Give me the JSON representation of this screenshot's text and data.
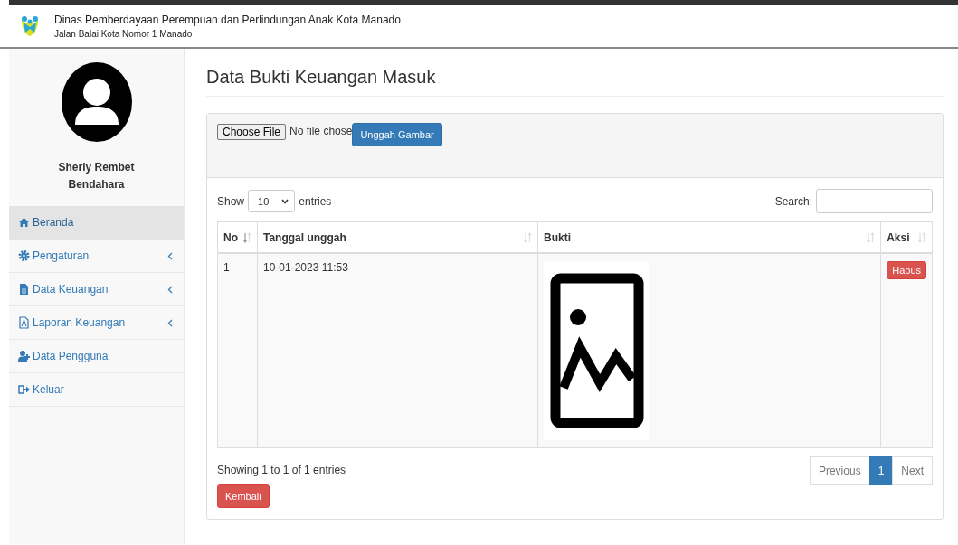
{
  "header": {
    "title": "Dinas Pemberdayaan Perempuan dan Perlindungan Anak Kota Manado",
    "subtitle": "Jalan Balai Kota Nomor 1 Manado"
  },
  "sidebar": {
    "user_name": "Sherly Rembet",
    "user_role": "Bendahara",
    "items": [
      {
        "label": "Beranda",
        "selected": true,
        "expandable": false
      },
      {
        "label": "Pengaturan",
        "selected": false,
        "expandable": true
      },
      {
        "label": "Data Keuangan",
        "selected": false,
        "expandable": true
      },
      {
        "label": "Laporan Keuangan",
        "selected": false,
        "expandable": true
      },
      {
        "label": "Data Pengguna",
        "selected": false,
        "expandable": false
      },
      {
        "label": "Keluar",
        "selected": false,
        "expandable": false
      }
    ]
  },
  "page_title": "Data Bukti Keuangan Masuk",
  "upload": {
    "choose_button": "Choose File",
    "file_status": "No file chose",
    "upload_button": "Unggah Gambar"
  },
  "table": {
    "show_label": "Show",
    "page_size": "10",
    "entries_label": "entries",
    "search_label": "Search:",
    "columns": [
      {
        "label": "No",
        "sorted": true
      },
      {
        "label": "Tanggal unggah",
        "sorted": false
      },
      {
        "label": "Bukti",
        "sorted": false
      },
      {
        "label": "Aksi",
        "sorted": false
      }
    ],
    "rows": [
      {
        "no": "1",
        "date": "10-01-2023 11:53",
        "action": "Hapus"
      }
    ],
    "info": "Showing 1 to 1 of 1 entries",
    "pagination": [
      {
        "label": "Previous",
        "selected": false
      },
      {
        "label": "1",
        "selected": true
      },
      {
        "label": "Next",
        "selected": false
      }
    ]
  },
  "back_button": "Kembali"
}
